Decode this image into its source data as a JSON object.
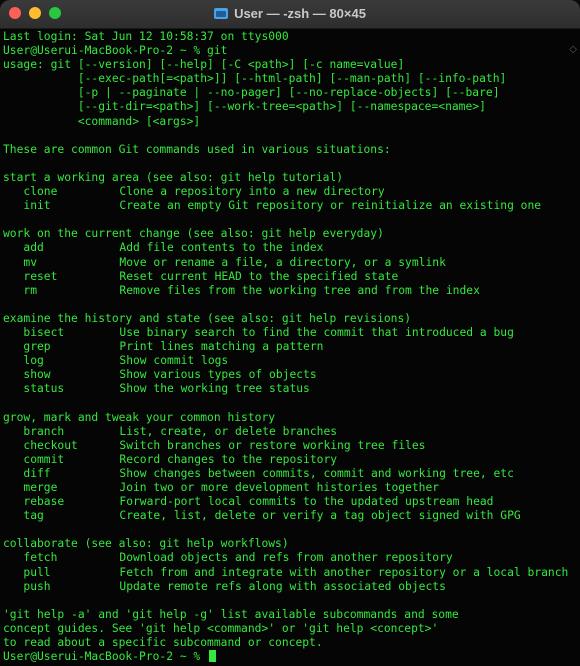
{
  "window": {
    "title": "User — -zsh — 80×45",
    "accent_green": "#35e83e"
  },
  "terminal": {
    "login": "Last login: Sat Jun 12 10:58:37 on ttys000",
    "prompt1": "User@Userui-MacBook-Pro-2 ~ % git",
    "usage": [
      "usage: git [--version] [--help] [-C <path>] [-c name=value]",
      "           [--exec-path[=<path>]] [--html-path] [--man-path] [--info-path]",
      "           [-p | --paginate | --no-pager] [--no-replace-objects] [--bare]",
      "           [--git-dir=<path>] [--work-tree=<path>] [--namespace=<name>]",
      "           <command> [<args>]"
    ],
    "intro": "These are common Git commands used in various situations:",
    "sections": [
      {
        "heading": "start a working area (see also: git help tutorial)",
        "commands": [
          {
            "name": "clone",
            "desc": "Clone a repository into a new directory"
          },
          {
            "name": "init",
            "desc": "Create an empty Git repository or reinitialize an existing one"
          }
        ]
      },
      {
        "heading": "work on the current change (see also: git help everyday)",
        "commands": [
          {
            "name": "add",
            "desc": "Add file contents to the index"
          },
          {
            "name": "mv",
            "desc": "Move or rename a file, a directory, or a symlink"
          },
          {
            "name": "reset",
            "desc": "Reset current HEAD to the specified state"
          },
          {
            "name": "rm",
            "desc": "Remove files from the working tree and from the index"
          }
        ]
      },
      {
        "heading": "examine the history and state (see also: git help revisions)",
        "commands": [
          {
            "name": "bisect",
            "desc": "Use binary search to find the commit that introduced a bug"
          },
          {
            "name": "grep",
            "desc": "Print lines matching a pattern"
          },
          {
            "name": "log",
            "desc": "Show commit logs"
          },
          {
            "name": "show",
            "desc": "Show various types of objects"
          },
          {
            "name": "status",
            "desc": "Show the working tree status"
          }
        ]
      },
      {
        "heading": "grow, mark and tweak your common history",
        "commands": [
          {
            "name": "branch",
            "desc": "List, create, or delete branches"
          },
          {
            "name": "checkout",
            "desc": "Switch branches or restore working tree files"
          },
          {
            "name": "commit",
            "desc": "Record changes to the repository"
          },
          {
            "name": "diff",
            "desc": "Show changes between commits, commit and working tree, etc"
          },
          {
            "name": "merge",
            "desc": "Join two or more development histories together"
          },
          {
            "name": "rebase",
            "desc": "Forward-port local commits to the updated upstream head"
          },
          {
            "name": "tag",
            "desc": "Create, list, delete or verify a tag object signed with GPG"
          }
        ]
      },
      {
        "heading": "collaborate (see also: git help workflows)",
        "commands": [
          {
            "name": "fetch",
            "desc": "Download objects and refs from another repository"
          },
          {
            "name": "pull",
            "desc": "Fetch from and integrate with another repository or a local branch"
          },
          {
            "name": "push",
            "desc": "Update remote refs along with associated objects"
          }
        ]
      }
    ],
    "footer": [
      "'git help -a' and 'git help -g' list available subcommands and some",
      "concept guides. See 'git help <command>' or 'git help <concept>'",
      "to read about a specific subcommand or concept."
    ],
    "prompt2": "User@Userui-MacBook-Pro-2 ~ % "
  }
}
